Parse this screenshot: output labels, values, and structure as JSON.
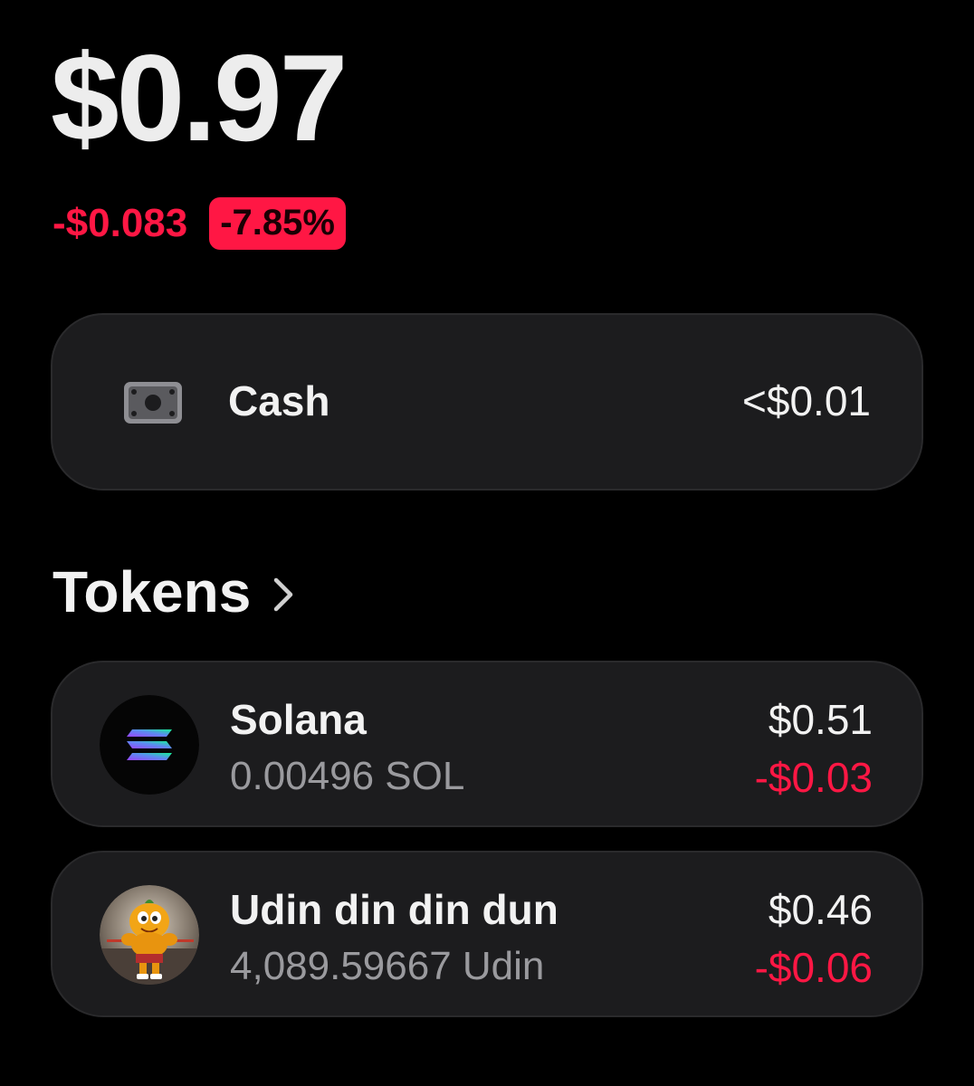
{
  "portfolio": {
    "balance": "$0.97",
    "change_amount": "-$0.083",
    "change_percent": "-7.85%"
  },
  "cash": {
    "icon": "cash-icon",
    "label": "Cash",
    "value": "<$0.01"
  },
  "tokens_section": {
    "title": "Tokens",
    "icon": "chevron-right-icon"
  },
  "tokens": [
    {
      "name": "Solana",
      "amount": "0.00496 SOL",
      "value": "$0.51",
      "change": "-$0.03",
      "icon": "solana-logo-icon"
    },
    {
      "name": "Udin din din dun",
      "amount": "4,089.59667 Udin",
      "value": "$0.46",
      "change": "-$0.06",
      "icon": "udin-token-avatar"
    }
  ],
  "colors": {
    "background": "#000000",
    "card": "#1c1c1e",
    "negative": "#ff1744",
    "text_primary": "#f2f2f2",
    "text_secondary": "#9a9a9e"
  }
}
